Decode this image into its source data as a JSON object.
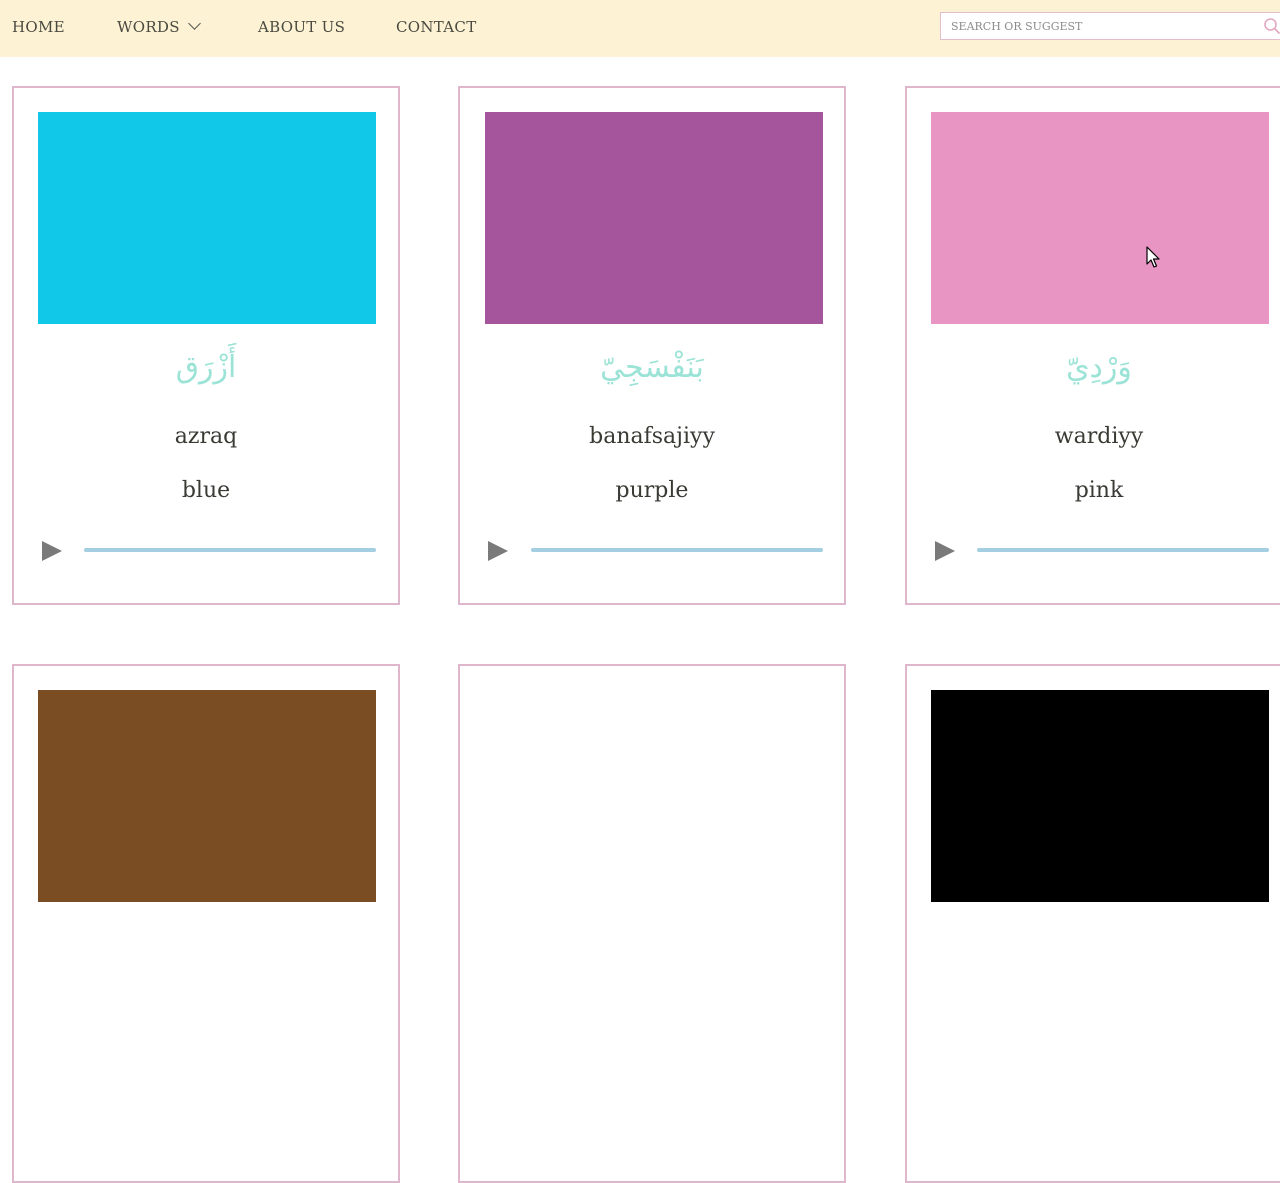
{
  "nav": {
    "home": "HOME",
    "words": "WORDS",
    "about": "ABOUT US",
    "contact": "CONTACT"
  },
  "search": {
    "placeholder": "SEARCH OR SUGGEST",
    "icon": "search-icon"
  },
  "colors": {
    "nav_background": "#fdf2d4",
    "card_border": "#dfb7cd",
    "arabic_text": "#9be3d6",
    "progress": "#a4cfe2"
  },
  "cards": [
    {
      "arabic": "أَزْرَق",
      "transliteration": "azraq",
      "english": "blue",
      "swatch_color": "#12c8e8",
      "progress": 0
    },
    {
      "arabic": "بَنَفْسَجِيّ",
      "transliteration": "banafsajiyy",
      "english": "purple",
      "swatch_color": "#a5559c",
      "progress": 0
    },
    {
      "arabic": "وَرْدِيّ",
      "transliteration": "wardiyy",
      "english": "pink",
      "swatch_color": "#e895c3",
      "progress": 0
    },
    {
      "swatch_color": "#7a4e22"
    },
    {
      "swatch_color": "#ffffff"
    },
    {
      "swatch_color": "#000000"
    }
  ]
}
